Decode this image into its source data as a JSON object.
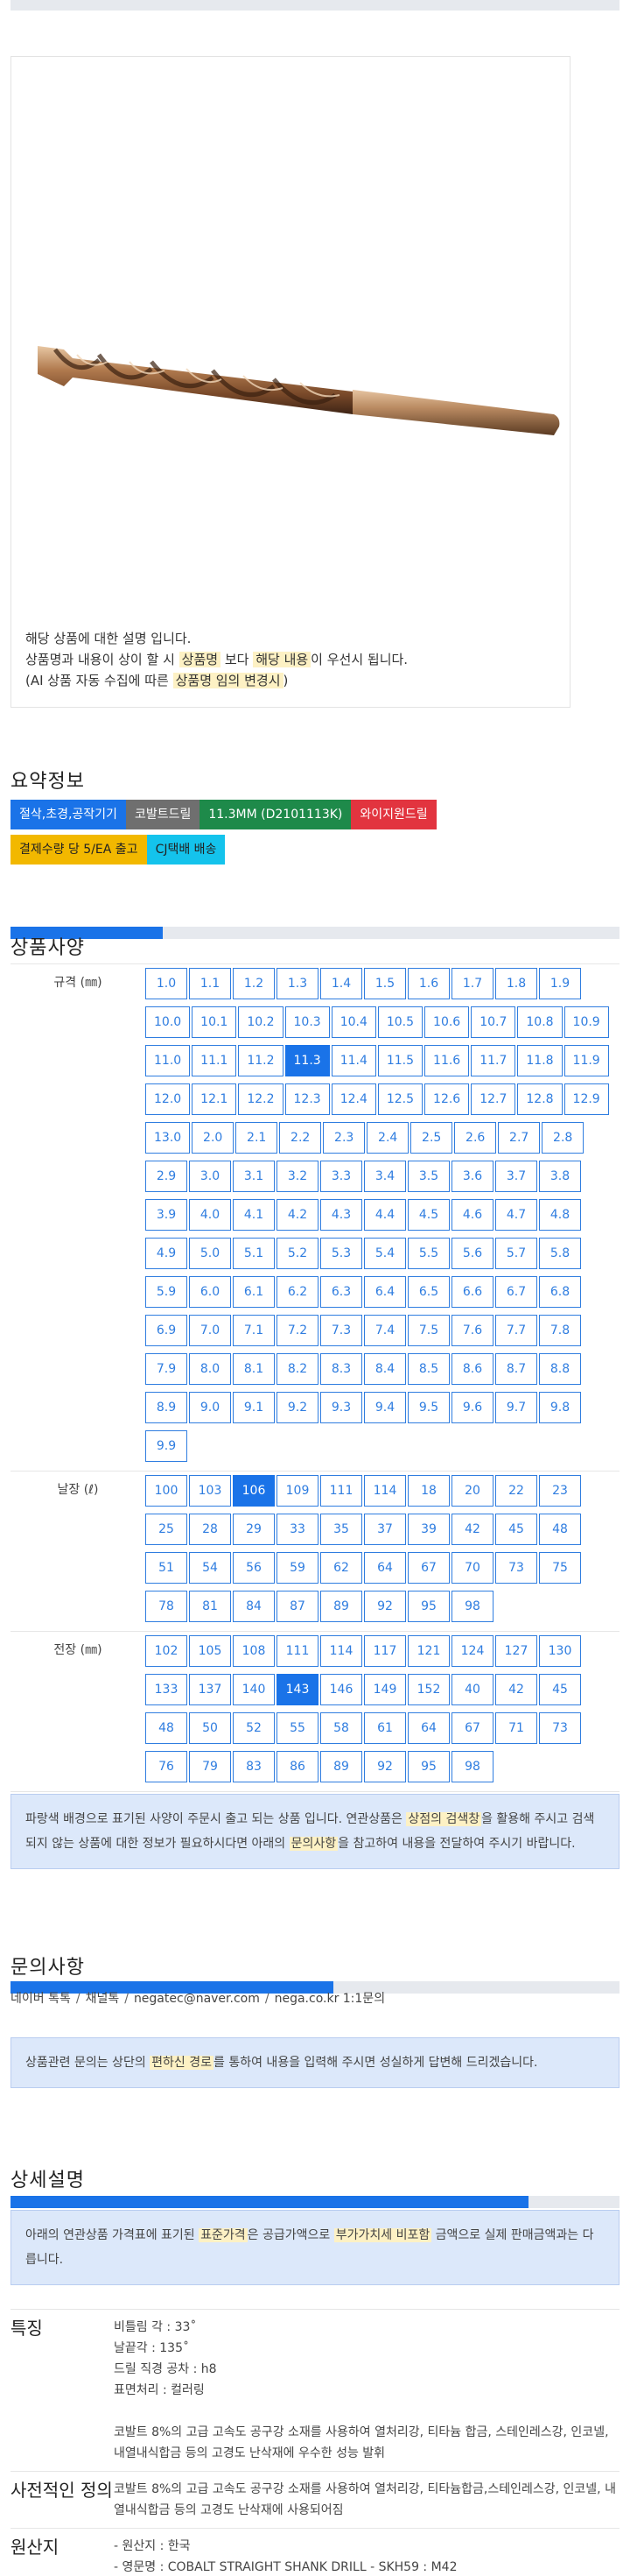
{
  "image": {
    "desc_line1": "해당 상품에 대한 설명 입니다.",
    "desc_line2_a": "상품명과 내용이 상이 할 시 ",
    "desc_line2_b": "상품명",
    "desc_line2_c": " 보다 ",
    "desc_line2_d": "해당 내용",
    "desc_line2_e": "이 우선시 됩니다.",
    "desc_line3_a": "(AI 상품 자동 수집에 따른 ",
    "desc_line3_b": "상품명 임의 변경시",
    "desc_line3_c": ")"
  },
  "summary": {
    "title": "요약정보",
    "tags": [
      {
        "label": "절삭,초경,공작기기",
        "color": "blue"
      },
      {
        "label": "코발트드릴",
        "color": "gray"
      },
      {
        "label": "11.3MM (D2101113K)",
        "color": "green"
      },
      {
        "label": "와이지원드릴",
        "color": "red"
      },
      {
        "label": "결제수량 당 5/EA 출고",
        "color": "yellow"
      },
      {
        "label": "CJ택배 배송",
        "color": "cyan"
      }
    ]
  },
  "spec": {
    "title": "상품사양",
    "progress": 0.25,
    "rows": [
      {
        "label": "규격 (㎜)",
        "selected": "11.3",
        "options": [
          "1.0",
          "1.1",
          "1.2",
          "1.3",
          "1.4",
          "1.5",
          "1.6",
          "1.7",
          "1.8",
          "1.9",
          "10.0",
          "10.1",
          "10.2",
          "10.3",
          "10.4",
          "10.5",
          "10.6",
          "10.7",
          "10.8",
          "10.9",
          "11.0",
          "11.1",
          "11.2",
          "11.3",
          "11.4",
          "11.5",
          "11.6",
          "11.7",
          "11.8",
          "11.9",
          "12.0",
          "12.1",
          "12.2",
          "12.3",
          "12.4",
          "12.5",
          "12.6",
          "12.7",
          "12.8",
          "12.9",
          "13.0",
          "2.0",
          "2.1",
          "2.2",
          "2.3",
          "2.4",
          "2.5",
          "2.6",
          "2.7",
          "2.8",
          "2.9",
          "3.0",
          "3.1",
          "3.2",
          "3.3",
          "3.4",
          "3.5",
          "3.6",
          "3.7",
          "3.8",
          "3.9",
          "4.0",
          "4.1",
          "4.2",
          "4.3",
          "4.4",
          "4.5",
          "4.6",
          "4.7",
          "4.8",
          "4.9",
          "5.0",
          "5.1",
          "5.2",
          "5.3",
          "5.4",
          "5.5",
          "5.6",
          "5.7",
          "5.8",
          "5.9",
          "6.0",
          "6.1",
          "6.2",
          "6.3",
          "6.4",
          "6.5",
          "6.6",
          "6.7",
          "6.8",
          "6.9",
          "7.0",
          "7.1",
          "7.2",
          "7.3",
          "7.4",
          "7.5",
          "7.6",
          "7.7",
          "7.8",
          "7.9",
          "8.0",
          "8.1",
          "8.2",
          "8.3",
          "8.4",
          "8.5",
          "8.6",
          "8.7",
          "8.8",
          "8.9",
          "9.0",
          "9.1",
          "9.2",
          "9.3",
          "9.4",
          "9.5",
          "9.6",
          "9.7",
          "9.8",
          "9.9"
        ]
      },
      {
        "label": "날장 (ℓ)",
        "selected": "106",
        "options": [
          "100",
          "103",
          "106",
          "109",
          "111",
          "114",
          "18",
          "20",
          "22",
          "23",
          "25",
          "28",
          "29",
          "33",
          "35",
          "37",
          "39",
          "42",
          "45",
          "48",
          "51",
          "54",
          "56",
          "59",
          "62",
          "64",
          "67",
          "70",
          "73",
          "75",
          "78",
          "81",
          "84",
          "87",
          "89",
          "92",
          "95",
          "98"
        ]
      },
      {
        "label": "전장 (㎜)",
        "selected": "143",
        "options": [
          "102",
          "105",
          "108",
          "111",
          "114",
          "117",
          "121",
          "124",
          "127",
          "130",
          "133",
          "137",
          "140",
          "143",
          "146",
          "149",
          "152",
          "40",
          "42",
          "45",
          "48",
          "50",
          "52",
          "55",
          "58",
          "61",
          "64",
          "67",
          "71",
          "73",
          "76",
          "79",
          "83",
          "86",
          "89",
          "92",
          "95",
          "98"
        ]
      }
    ],
    "notice_a": "파랑색 배경으로 표기된 사양이 주문시 출고 되는 상품 입니다. 연관상품은 ",
    "notice_b": "상점의 검색창",
    "notice_c": "을 활용해 주시고 검색되지 않는 상품에 대한 정보가 필요하시다면 아래의 ",
    "notice_d": "문의사항",
    "notice_e": "을 참고하여 내용을 전달하여 주시기 바랍니다."
  },
  "inquiry": {
    "title": "문의사항",
    "progress": 0.53,
    "items": [
      "네이버 톡톡",
      "채널톡",
      "negatec@naver.com",
      "nega.co.kr 1:1문의"
    ],
    "notice_a": "상품관련 문의는 상단의 ",
    "notice_b": "편하신 경로",
    "notice_c": "를 통하여 내용을 입력해 주시면 성실하게 답변해 드리겠습니다."
  },
  "detail": {
    "title": "상세설명",
    "progress": 0.85,
    "notice_a": "아래의 연관상품 가격표에 표기된 ",
    "notice_b": "표준가격",
    "notice_c": "은 공급가액으로 ",
    "notice_d": "부가가치세 비포함",
    "notice_e": " 금액으로 실제 판매금액과는 다릅니다.",
    "rows": [
      {
        "label": "특징",
        "lines": [
          "비틀림 각 : 33˚",
          "날끝각 : 135˚",
          "드릴 직경 공차 : h8",
          "표면처리 : 컬러링",
          "",
          "코발트 8%의 고급 고속도 공구강 소재를 사용하여 열처리강, 티타늄 합금, 스테인레스강, 인코넬, 내열내식합금 등의 고경도 난삭재에 우수한 성능 발휘"
        ]
      },
      {
        "label": "사전적인 정의",
        "lines": [
          "코발트 8%의 고급 고속도 공구강 소재를 사용하여 열처리강, 티타늄합금,스테인레스강, 인코넬, 내열내식합금 등의 고경도 난삭재에 사용되어짐"
        ]
      },
      {
        "label": "원산지",
        "lines": [
          "- 원산지 : 한국",
          "- 영문명 : COBALT STRAIGHT SHANK DRILL - SKH59 : M42"
        ]
      }
    ]
  }
}
